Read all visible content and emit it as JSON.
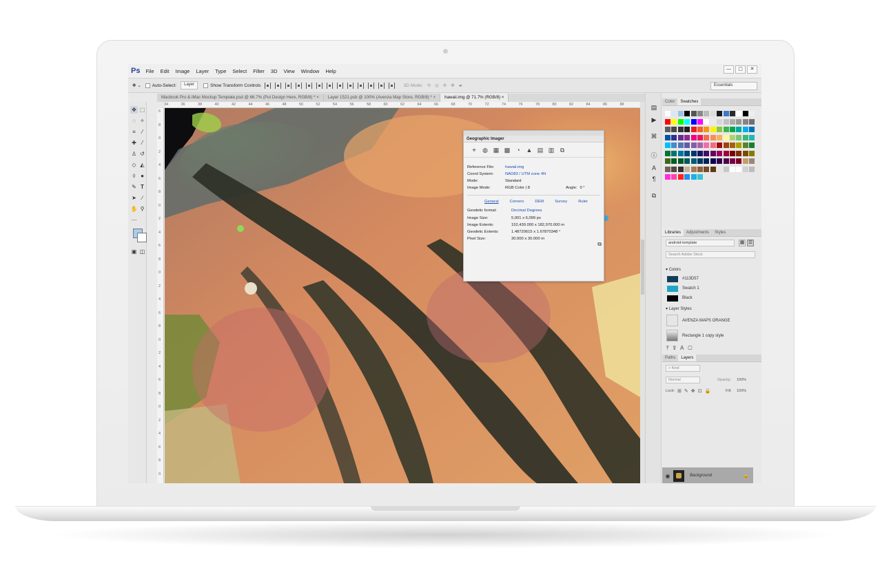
{
  "app": {
    "logo": "Ps",
    "menus": [
      "File",
      "Edit",
      "Image",
      "Layer",
      "Type",
      "Select",
      "Filter",
      "3D",
      "View",
      "Window",
      "Help"
    ],
    "window_controls": [
      "—",
      "▢",
      "✕"
    ]
  },
  "options": {
    "auto_select_label": "Auto-Select:",
    "auto_select_value": "Layer",
    "show_transform_label": "Show Transform Controls",
    "mode_3d_label": "3D Mode:",
    "workspace": "Essentials"
  },
  "tabs": [
    {
      "label": "Macbook Pro & iMac Mockup Template.psd @ 66.7% (Put Design Here, RGB/8) *",
      "active": false
    },
    {
      "label": "Layer 1521.psb @ 100% (Avenza Map Store, RGB/8) *",
      "active": false
    },
    {
      "label": "hawaii.img @ 71.7% (RGB/8)",
      "active": true
    }
  ],
  "ruler": {
    "h_ticks": [
      "34",
      "36",
      "38",
      "40",
      "42",
      "44",
      "46",
      "48",
      "50",
      "52",
      "54",
      "56",
      "58",
      "60",
      "62",
      "64",
      "66",
      "68",
      "70",
      "72",
      "74",
      "76",
      "78",
      "80",
      "82",
      "84",
      "86",
      "88"
    ],
    "v_ticks": [
      "6",
      "8",
      "0",
      "2",
      "4",
      "6",
      "8",
      "0",
      "2",
      "4",
      "6",
      "8",
      "0",
      "2",
      "4",
      "6",
      "8",
      "0",
      "2",
      "4",
      "6",
      "8",
      "0",
      "2",
      "4",
      "6",
      "8",
      "0"
    ]
  },
  "geo_panel": {
    "title": "Geographic Imager",
    "reference_file_label": "Reference File:",
    "reference_file": "hawaii.img",
    "coord_system_label": "Coord System:",
    "coord_system": "NAD83 / UTM zone 4N",
    "mode_label": "Mode:",
    "mode": "Standard",
    "image_mode_label": "Image Mode:",
    "image_mode": "RGB Color | 8",
    "angle_label": "Angle:",
    "angle": "0 °",
    "subtabs": [
      "General",
      "Corners",
      "DEM",
      "Survey",
      "Ruler"
    ],
    "geodetic_format_label": "Geodetic format:",
    "geodetic_format": "Decimal Degrees",
    "image_size_label": "Image Size:",
    "image_size": "5,001 x 6,099 px",
    "image_extents_label": "Image Extents:",
    "image_extents": "152,430.000 x 182,970.000 m",
    "geodetic_extents_label": "Geodetic Extents:",
    "geodetic_extents": "1.48720615 x 1.67870348 °",
    "pixel_size_label": "Pixel Size:",
    "pixel_size": "30.000 x 30.000 m"
  },
  "color_panel": {
    "tabs": [
      "Color",
      "Swatches"
    ],
    "active_tab": "Swatches"
  },
  "libraries": {
    "tabs": [
      "Libraries",
      "Adjustments",
      "Styles"
    ],
    "library_name": "android-template",
    "search_placeholder": "Search Adobe Stock",
    "colors_header": "Colors",
    "colors": [
      {
        "name": "#113D57",
        "hex": "#113D57"
      },
      {
        "name": "Swatch 1",
        "hex": "#1DA7C4"
      },
      {
        "name": "Black",
        "hex": "#000000"
      }
    ],
    "styles_header": "Layer Styles",
    "styles": [
      "AVENZA MAPS ORANGE",
      "Rectangle 1 copy style"
    ]
  },
  "layers": {
    "tabs": [
      "Paths",
      "Layers"
    ],
    "kind_label": "Kind",
    "blend_mode": "Normal",
    "opacity_label": "Opacity:",
    "opacity": "100%",
    "lock_label": "Lock:",
    "fill_label": "Fill:",
    "fill": "100%",
    "layer_name": "Background"
  },
  "colors": {
    "fg_color": "#a9cdf3",
    "accent_link": "#1a4fb3"
  }
}
